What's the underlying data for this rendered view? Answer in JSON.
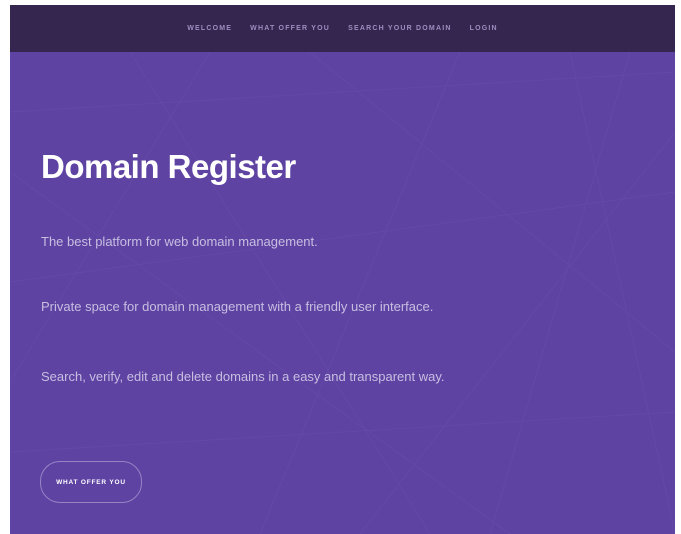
{
  "nav": {
    "items": [
      {
        "label": "WELCOME"
      },
      {
        "label": "WHAT OFFER YOU"
      },
      {
        "label": "SEARCH YOUR DOMAIN"
      },
      {
        "label": "LOGIN"
      }
    ]
  },
  "hero": {
    "title": "Domain Register",
    "lines": [
      "The best platform for web domain management.",
      "Private space for domain management with a friendly user interface.",
      "Search, verify, edit and delete domains in a easy and transparent way."
    ],
    "cta_label": "WHAT OFFER YOU"
  },
  "colors": {
    "nav_background": "#34264f",
    "hero_background": "#5e43a3",
    "nav_text": "#9c8fc0",
    "body_text": "#c7bee0",
    "title_text": "#ffffff"
  }
}
